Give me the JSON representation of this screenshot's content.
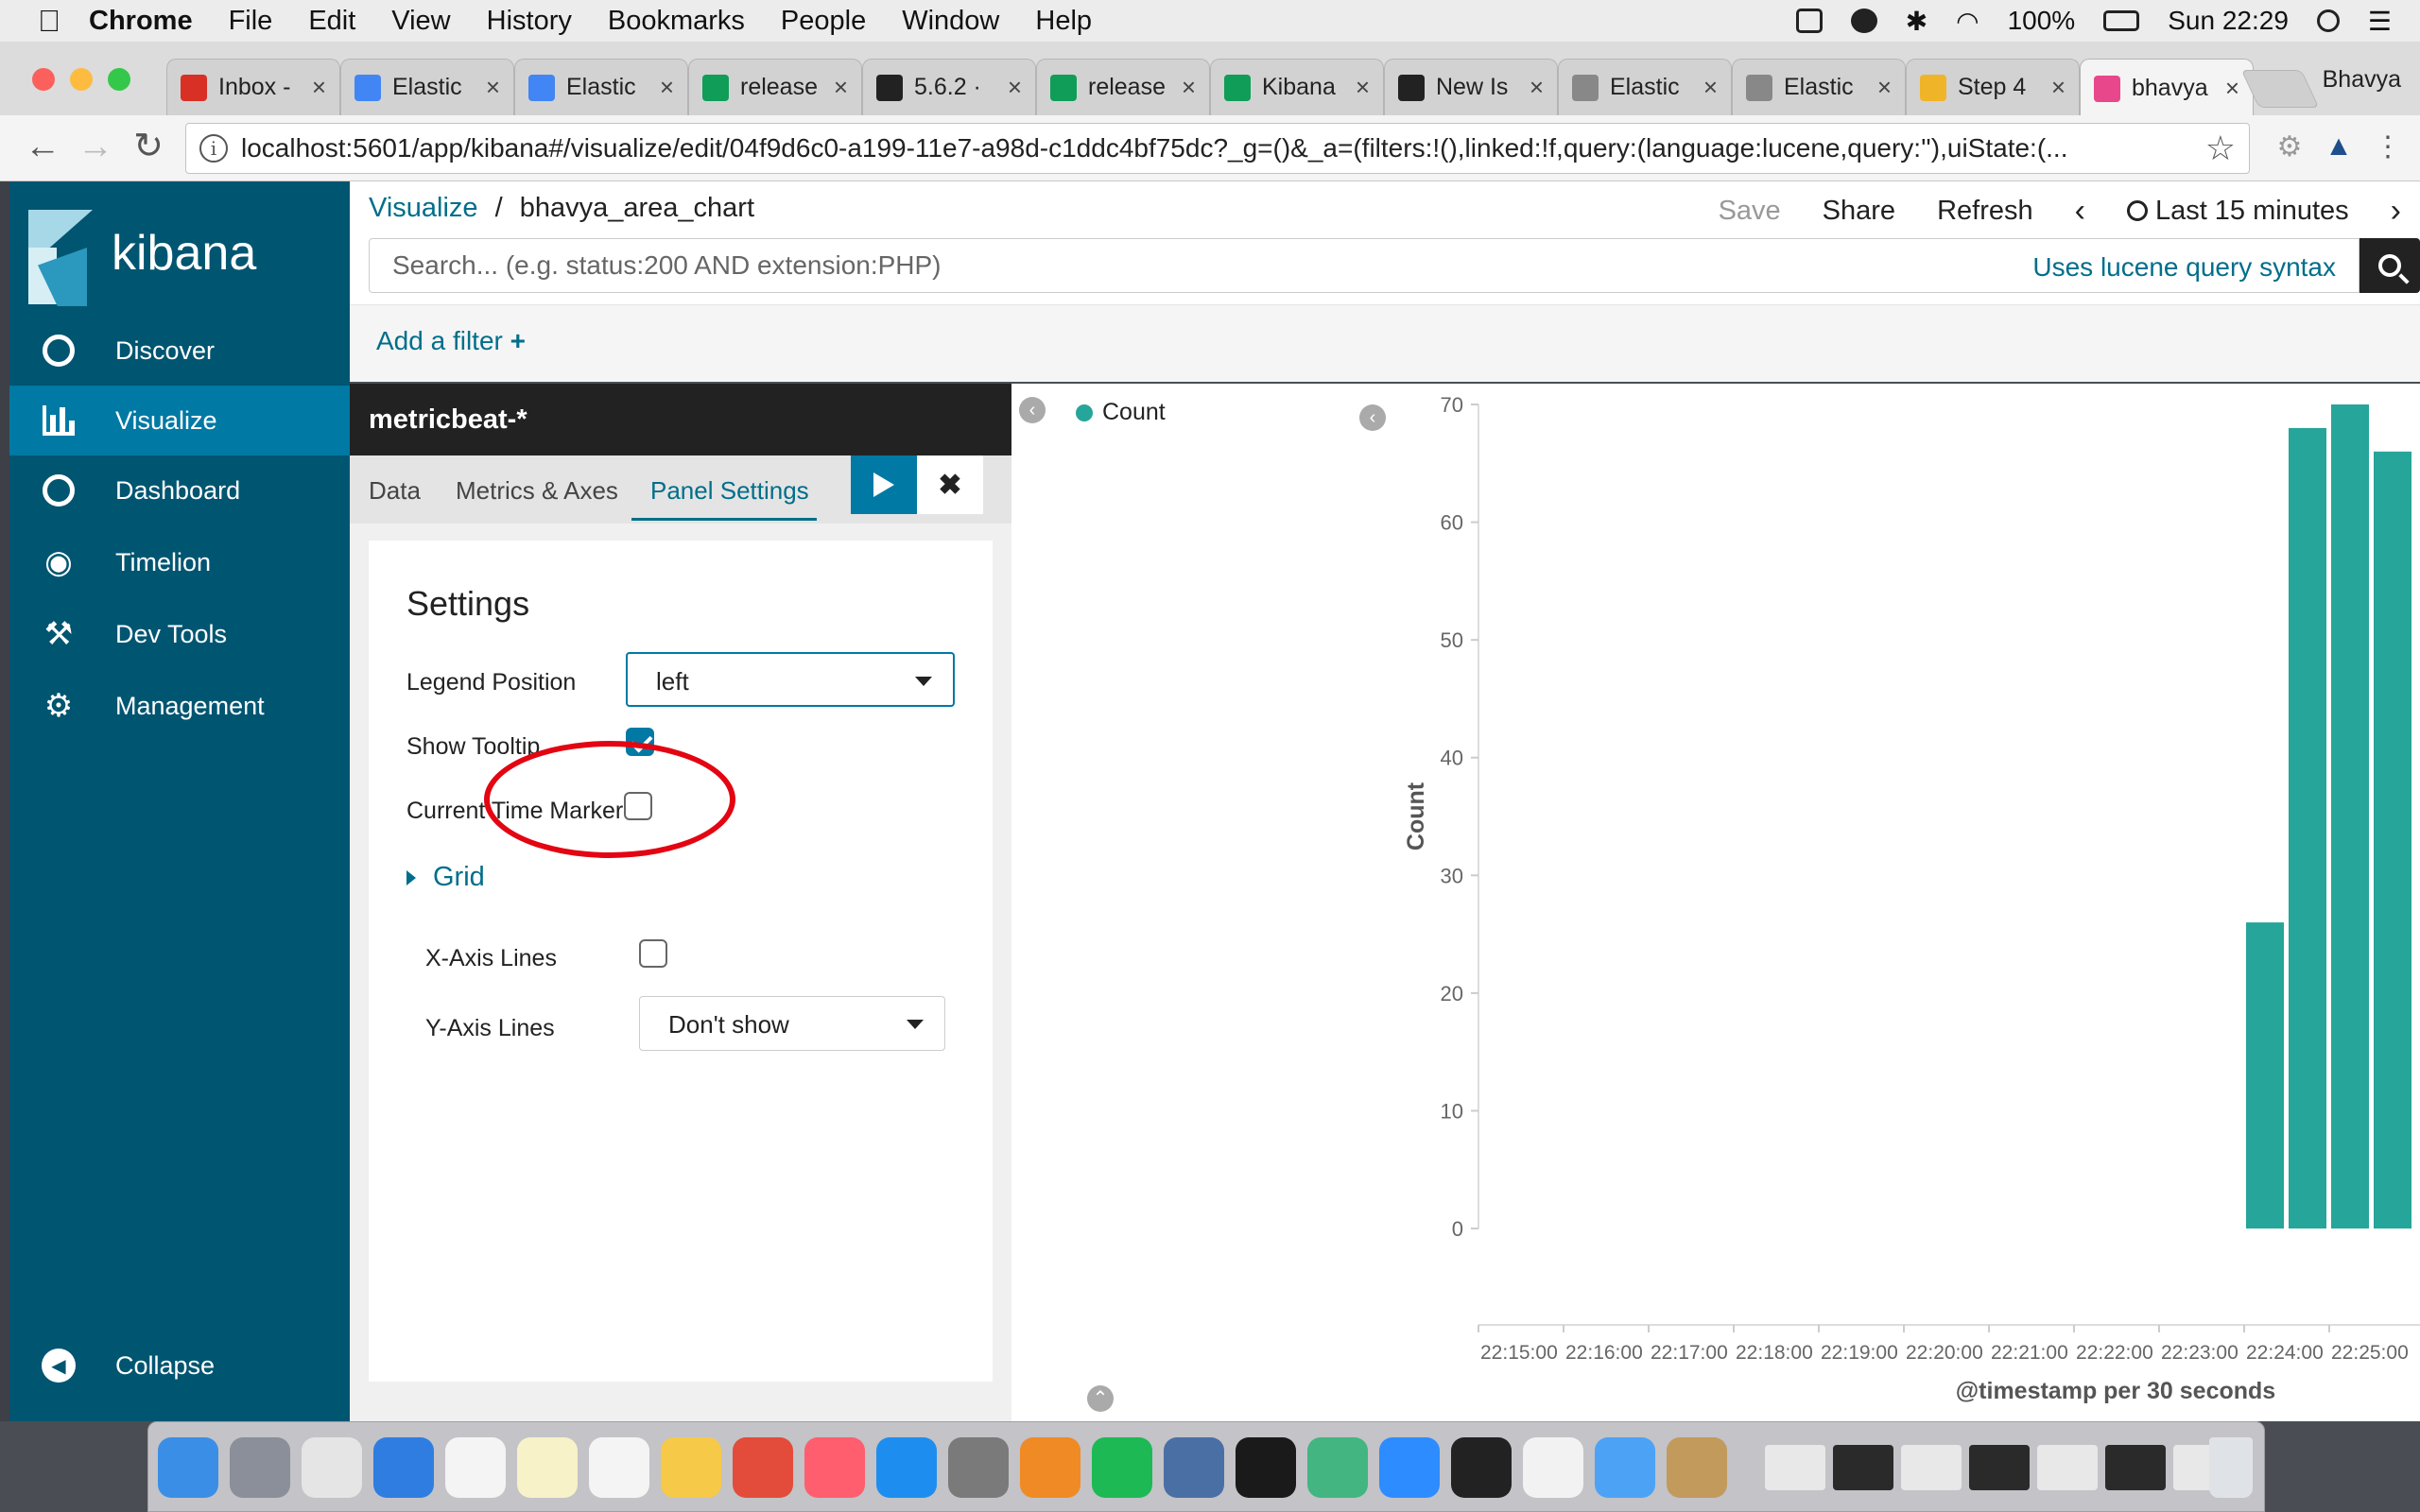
{
  "menubar": {
    "app": "Chrome",
    "items": [
      "File",
      "Edit",
      "View",
      "History",
      "Bookmarks",
      "People",
      "Window",
      "Help"
    ],
    "battery": "100%",
    "clock": "Sun 22:29"
  },
  "tabs": [
    {
      "title": "Inbox -",
      "color": "#d93025"
    },
    {
      "title": "Elastic",
      "color": "#4285f4"
    },
    {
      "title": "Elastic",
      "color": "#4285f4"
    },
    {
      "title": "release",
      "color": "#0f9d58"
    },
    {
      "title": "5.6.2 ·",
      "color": "#222222"
    },
    {
      "title": "release",
      "color": "#0f9d58"
    },
    {
      "title": "Kibana",
      "color": "#0f9d58"
    },
    {
      "title": "New Is",
      "color": "#222222"
    },
    {
      "title": "Elastic",
      "color": "#888888"
    },
    {
      "title": "Elastic",
      "color": "#888888"
    },
    {
      "title": "Step 4",
      "color": "#f0b429"
    },
    {
      "title": "bhavya",
      "color": "#e8478b"
    }
  ],
  "profile": "Bhavya",
  "url": "localhost:5601/app/kibana#/visualize/edit/04f9d6c0-a199-11e7-a98d-c1ddc4bf75dc?_g=()&_a=(filters:!(),linked:!f,query:(language:lucene,query:''),uiState:(...",
  "brand": "kibana",
  "nav": [
    {
      "label": "Discover",
      "icon": "compass-icon"
    },
    {
      "label": "Visualize",
      "icon": "bar-chart-icon"
    },
    {
      "label": "Dashboard",
      "icon": "dashboard-icon"
    },
    {
      "label": "Timelion",
      "icon": "timelion-icon"
    },
    {
      "label": "Dev Tools",
      "icon": "wrench-icon"
    },
    {
      "label": "Management",
      "icon": "gear-icon"
    }
  ],
  "collapse": "Collapse",
  "header": {
    "crumb_root": "Visualize",
    "crumb_sep": "/",
    "crumb_current": "bhavya_area_chart",
    "save": "Save",
    "share": "Share",
    "refresh": "Refresh",
    "time": "Last 15 minutes"
  },
  "search": {
    "placeholder": "Search... (e.g. status:200 AND extension:PHP)",
    "syntax": "Uses lucene query syntax"
  },
  "add_filter": "Add a filter",
  "editor": {
    "index": "metricbeat-*",
    "tabs": [
      "Data",
      "Metrics & Axes",
      "Panel Settings"
    ],
    "settings_title": "Settings",
    "legend_position_label": "Legend Position",
    "legend_position_value": "left",
    "show_tooltip_label": "Show Tooltip",
    "show_tooltip": true,
    "current_time_marker_label": "Current Time Marker",
    "current_time_marker": false,
    "grid_label": "Grid",
    "x_axis_lines_label": "X-Axis Lines",
    "x_axis_lines": false,
    "y_axis_lines_label": "Y-Axis Lines",
    "y_axis_lines_value": "Don't show"
  },
  "colors": {
    "sidebar": "#005571",
    "sidebar_active": "#0079a5",
    "link": "#006e8a",
    "bar": "#26a59a",
    "highlight": "#e30512"
  },
  "chart_data": {
    "type": "bar",
    "legend": [
      "Count"
    ],
    "legend_position": "left",
    "ylabel": "Count",
    "xlabel": "@timestamp per 30 seconds",
    "ylim": [
      0,
      70
    ],
    "yticks": [
      0,
      10,
      20,
      30,
      40,
      50,
      60,
      70
    ],
    "xticks": [
      "22:15:00",
      "22:16:00",
      "22:17:00",
      "22:18:00",
      "22:19:00",
      "22:20:00",
      "22:21:00",
      "22:22:00",
      "22:23:00",
      "22:24:00",
      "22:25:00"
    ],
    "series": [
      {
        "name": "Count",
        "values": [
          {
            "x": "22:24:00",
            "y": 26
          },
          {
            "x": "22:24:30",
            "y": 68
          },
          {
            "x": "22:25:00",
            "y": 70
          },
          {
            "x": "22:25:30",
            "y": 66
          }
        ]
      }
    ]
  }
}
